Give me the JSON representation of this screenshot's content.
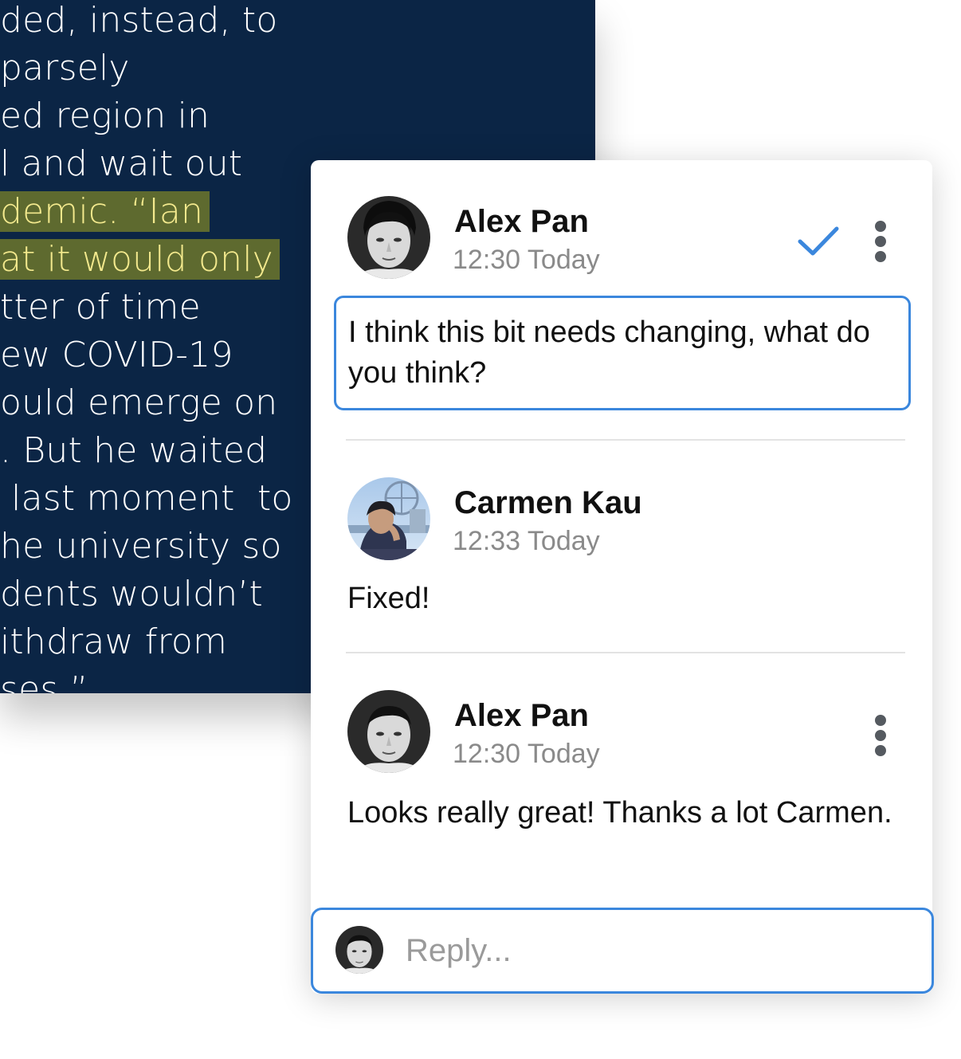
{
  "article": {
    "lines": [
      "ded, instead, to",
      "parsely",
      "ed region in",
      "l and wait out",
      "demic. “Ian",
      "at it would only",
      "tter of time",
      "ew COVID-19",
      "ould emerge on",
      ". But he waited",
      " last moment  to",
      "he university so",
      "dents wouldn’t",
      "ithdraw from",
      "ses.”"
    ],
    "highlight_color": "#5e6a2f"
  },
  "comments": [
    {
      "author": "Alex Pan",
      "time": "12:30 Today",
      "text": "I think this bit needs changing, what do you think?",
      "resolved_icon": "checkmark-icon",
      "menu_icon": "more-vertical-icon"
    },
    {
      "author": "Carmen Kau",
      "time": "12:33 Today",
      "text": "Fixed!"
    },
    {
      "author": "Alex Pan",
      "time": "12:30 Today",
      "text": "Looks really great! Thanks a lot Carmen.",
      "menu_icon": "more-vertical-icon"
    }
  ],
  "reply": {
    "placeholder": "Reply..."
  },
  "colors": {
    "accent": "#3b87dd",
    "article_bg": "#0b2545"
  }
}
